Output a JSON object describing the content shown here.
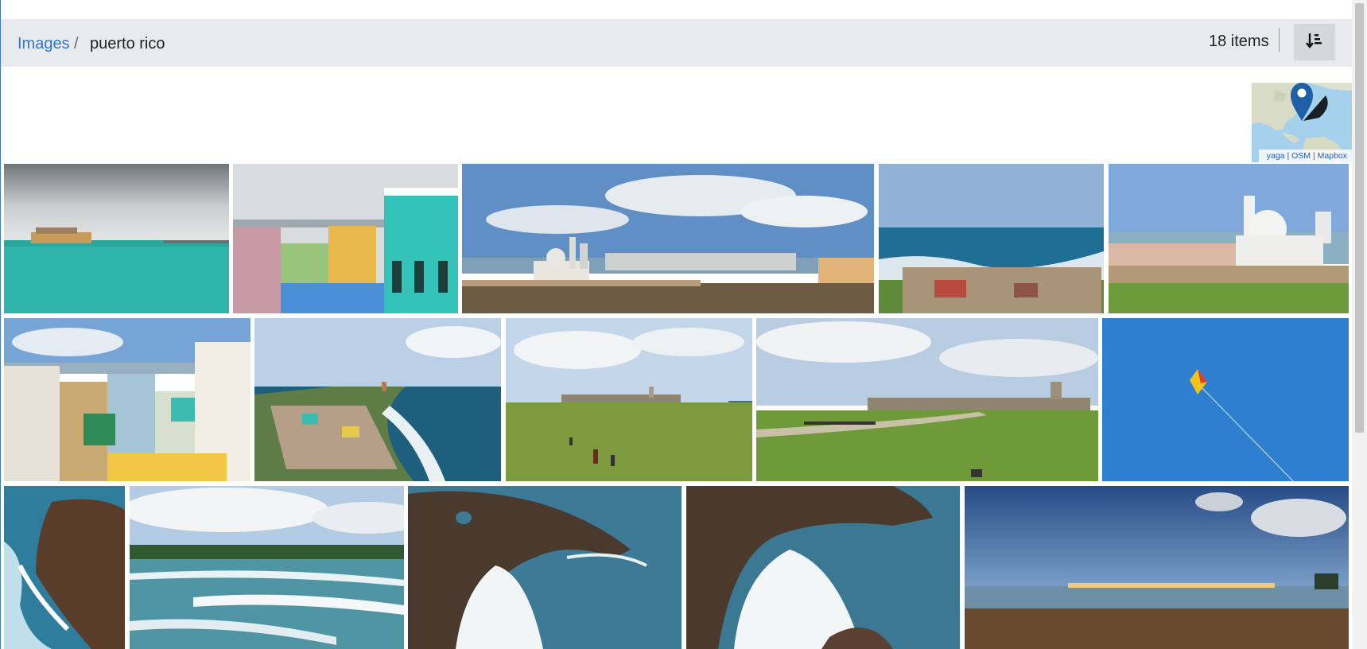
{
  "breadcrumb": {
    "root_label": "Images",
    "separator": "/",
    "current_label": "puerto rico"
  },
  "header": {
    "item_count": "18 items",
    "sort_icon": "sort-descending-icon"
  },
  "map": {
    "marker_icon": "map-pin-icon",
    "attribution": [
      "yaga",
      "OSM",
      "Mapbox"
    ]
  },
  "gallery": {
    "rows": [
      {
        "photos": [
          "storm-over-bay",
          "colorful-colonial-buildings",
          "city-skyline-panorama",
          "fortress-and-ocean",
          "capitol-dome-view"
        ]
      },
      {
        "photos": [
          "old-san-juan-rooftops",
          "la-perla-coastline",
          "el-morro-lawn-people",
          "el-morro-fort-lawn",
          "kite-in-blue-sky"
        ]
      },
      {
        "photos": [
          "rocky-coast-waves",
          "beach-waves-palms",
          "rock-arch-wave-splash",
          "rock-wave-crash",
          "beach-at-dusk-lights"
        ]
      }
    ]
  },
  "colors": {
    "link_blue": "#3277d6",
    "toolbar_gray": "#e8eaed",
    "map_pin": "#1f5fa6"
  }
}
